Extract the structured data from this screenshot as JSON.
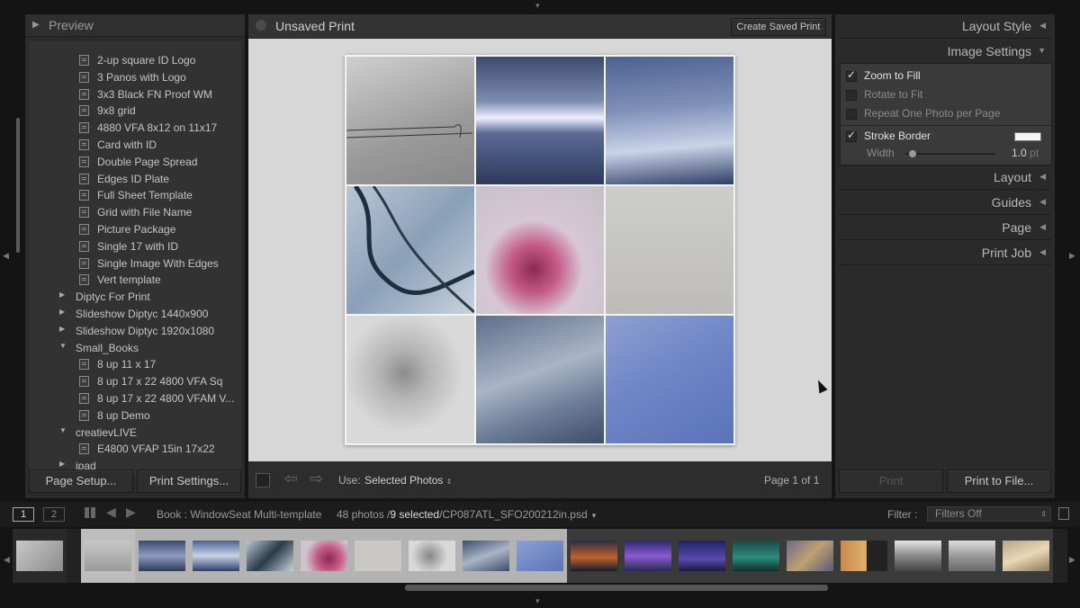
{
  "left_panel": {
    "header": "Preview",
    "templates": [
      {
        "kind": "item",
        "label": "2-up square ID Logo"
      },
      {
        "kind": "item",
        "label": "3 Panos with Logo"
      },
      {
        "kind": "item",
        "label": "3x3 Black FN Proof WM"
      },
      {
        "kind": "item",
        "label": "9x8 grid"
      },
      {
        "kind": "item",
        "label": "4880 VFA 8x12 on 11x17"
      },
      {
        "kind": "item",
        "label": "Card with ID"
      },
      {
        "kind": "item",
        "label": "Double Page Spread"
      },
      {
        "kind": "item",
        "label": "Edges ID Plate"
      },
      {
        "kind": "item",
        "label": "Full Sheet Template"
      },
      {
        "kind": "item",
        "label": "Grid with File Name"
      },
      {
        "kind": "item",
        "label": "Picture Package"
      },
      {
        "kind": "item",
        "label": "Single 17 with ID"
      },
      {
        "kind": "item",
        "label": "Single Image With Edges"
      },
      {
        "kind": "item",
        "label": "Vert template"
      },
      {
        "kind": "folder",
        "label": "Diptyc For Print",
        "glyph": "▶"
      },
      {
        "kind": "folder",
        "label": "Slideshow Diptyc 1440x900",
        "glyph": "▶"
      },
      {
        "kind": "folder",
        "label": "Slideshow Diptyc 1920x1080",
        "glyph": "▶"
      },
      {
        "kind": "folder",
        "label": "Small_Books",
        "glyph": "▼"
      },
      {
        "kind": "item",
        "label": "8 up 11 x 17"
      },
      {
        "kind": "item",
        "label": "8 up 17 x 22 4800 VFA Sq"
      },
      {
        "kind": "item",
        "label": "8 up 17 x 22 4800 VFAM V..."
      },
      {
        "kind": "item",
        "label": "8 up Demo"
      },
      {
        "kind": "folder",
        "label": "creatievLIVE",
        "glyph": "▼"
      },
      {
        "kind": "item",
        "label": "E4800 VFAP 15in 17x22"
      },
      {
        "kind": "folder",
        "label": "ipad",
        "glyph": "▶"
      }
    ],
    "page_setup": "Page Setup...",
    "print_settings": "Print Settings..."
  },
  "center": {
    "title": "Unsaved Print",
    "create_saved_print": "Create Saved Print",
    "use_label": "Use:",
    "use_value": "Selected Photos",
    "page_info": "Page 1 of 1"
  },
  "right_panel": {
    "layout_style": "Layout Style",
    "image_settings": "Image Settings",
    "options": [
      {
        "label": "Zoom to Fill",
        "checked": true
      },
      {
        "label": "Rotate to Fit",
        "checked": false
      },
      {
        "label": "Repeat One Photo per Page",
        "checked": false
      }
    ],
    "stroke_border": "Stroke Border",
    "stroke_checked": true,
    "width_label": "Width",
    "width_value": "1.0",
    "width_unit": "pt",
    "layout": "Layout",
    "guides": "Guides",
    "page": "Page",
    "print_job": "Print Job",
    "print": "Print",
    "print_to_file": "Print to File..."
  },
  "filmbar": {
    "view1": "1",
    "view2": "2",
    "source": "Book : WindowSeat Multi-template",
    "count": "48 photos /",
    "selected": "9 selected",
    "filename": "/CP087ATL_SFO200212in.psd",
    "filter_label": "Filter :",
    "filter_value": "Filters Off"
  },
  "colors": {
    "accent_bg": "#2a2a2a",
    "canvas": "#d7d7d7"
  }
}
